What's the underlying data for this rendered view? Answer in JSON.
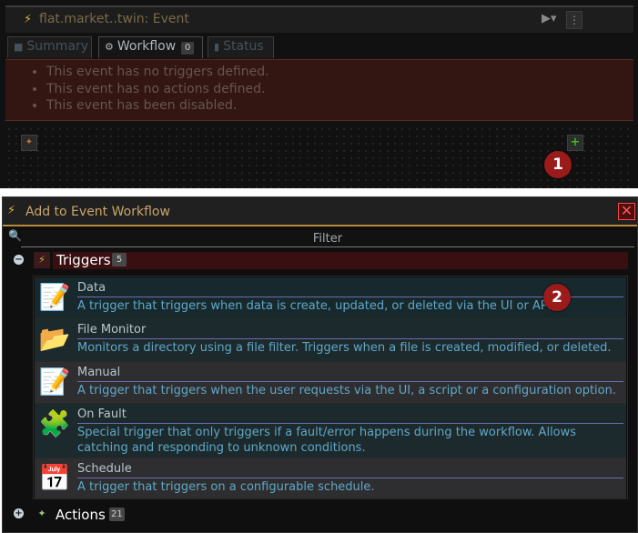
{
  "event_panel": {
    "title": "flat.market..twin: Event",
    "tabs": [
      {
        "label": "Summary",
        "icon": "document-icon",
        "active": false
      },
      {
        "label": "Workflow",
        "icon": "workflow-icon",
        "active": true,
        "badge": "0"
      },
      {
        "label": "Status",
        "icon": "status-icon",
        "active": false
      }
    ],
    "warnings": [
      "This event has no triggers defined.",
      "This event has no actions defined.",
      "This event has been disabled."
    ],
    "callout_1": "1"
  },
  "dialog": {
    "title": "Add to Event Workflow",
    "filter_placeholder": "Filter",
    "callout_2": "2",
    "triggers_group": {
      "label": "Triggers",
      "count": "5",
      "items": [
        {
          "name": "Data",
          "description": "A trigger that triggers when data is create, updated, or deleted via the UI or APIs.",
          "icon": "data-trigger-icon"
        },
        {
          "name": "File Monitor",
          "description": "Monitors a directory using a file filter. Triggers when a file is created, modified, or deleted.",
          "icon": "folder-icon"
        },
        {
          "name": "Manual",
          "description": "A trigger that triggers when the user requests via the UI, a script or a configuration option.",
          "icon": "manual-trigger-icon"
        },
        {
          "name": "On Fault",
          "description": "Special trigger that only triggers if a fault/error happens during the workflow. Allows catching and responding to unknown conditions.",
          "icon": "fault-icon"
        },
        {
          "name": "Schedule",
          "description": "A trigger that triggers on a configurable schedule.",
          "icon": "schedule-icon"
        }
      ]
    },
    "actions_group": {
      "label": "Actions",
      "count": "21"
    }
  },
  "colors": {
    "accent": "#b88a3a",
    "warning_bg": "#331512",
    "trigger_desc": "#5fa8c6",
    "callout": "#9b1b1b"
  }
}
